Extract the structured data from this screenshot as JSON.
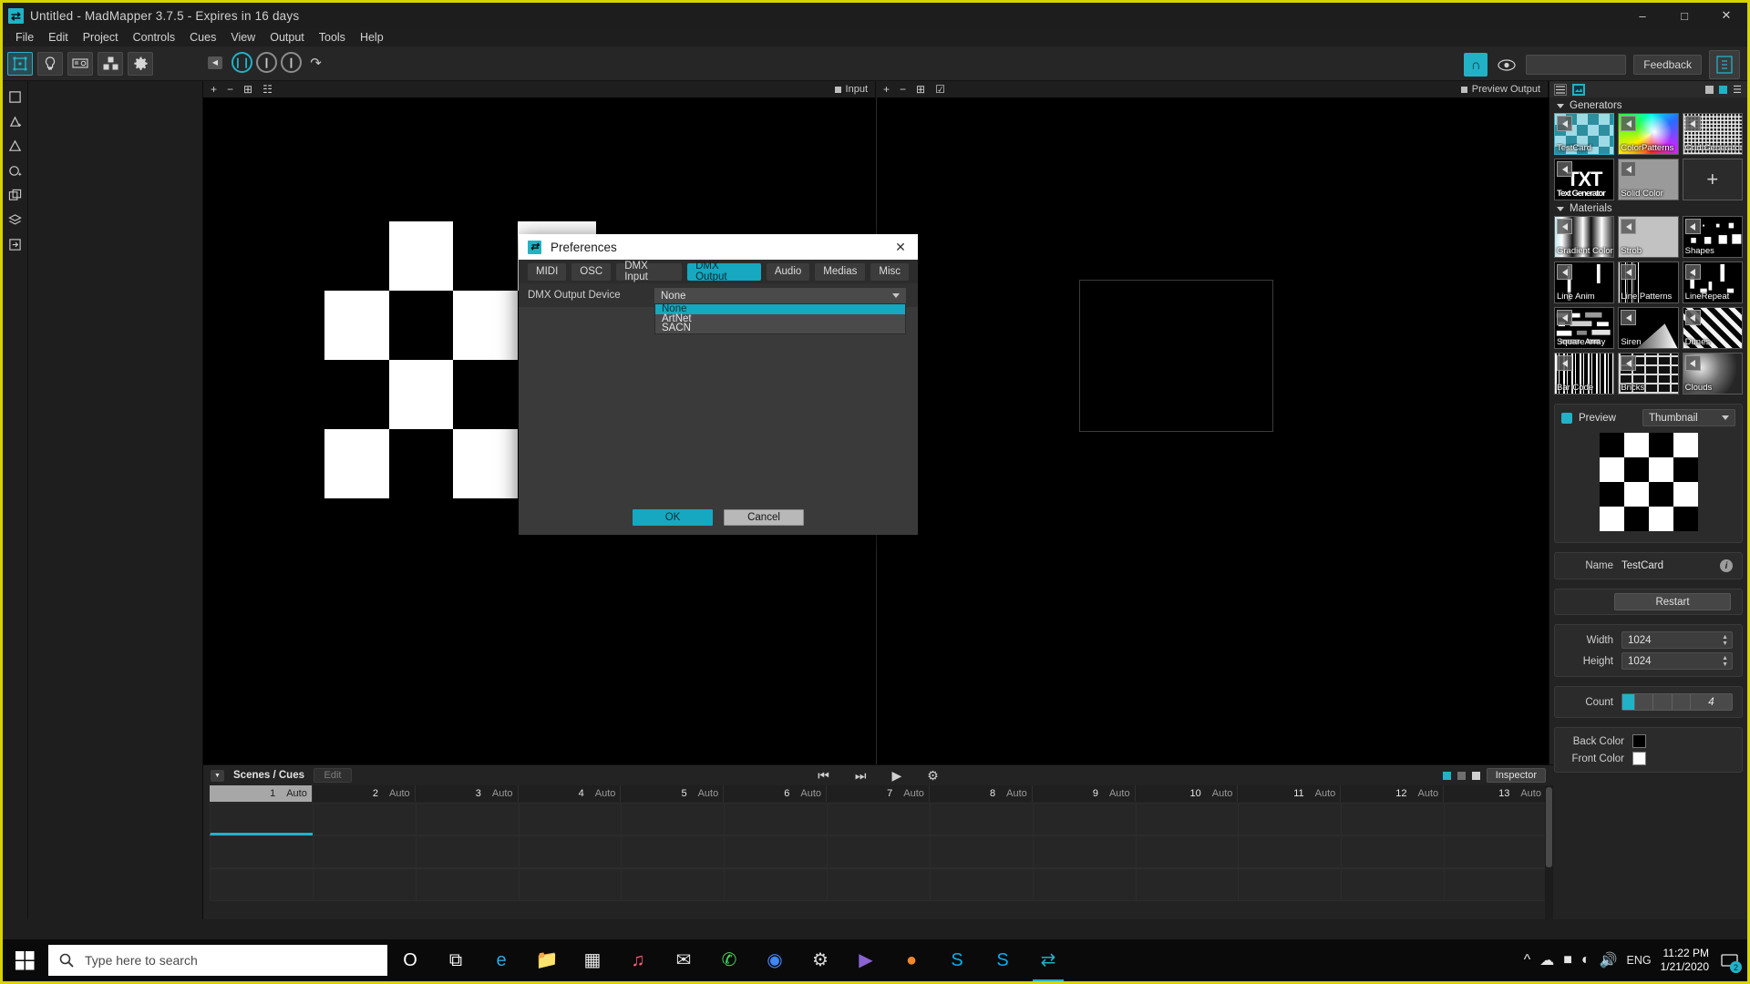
{
  "window": {
    "title": "Untitled - MadMapper 3.7.5 - Expires in 16 days",
    "app_icon": "madmapper-icon",
    "minimize": "minimize-icon",
    "maximize": "maximize-icon",
    "close": "close-icon"
  },
  "menu": {
    "items": [
      "File",
      "Edit",
      "Project",
      "Controls",
      "Cues",
      "View",
      "Output",
      "Tools",
      "Help"
    ]
  },
  "toolbar": {
    "buttons": [
      {
        "name": "surfaces-tool",
        "icon": "surface-icon",
        "active": true
      },
      {
        "name": "lights-tool",
        "icon": "bulb-icon",
        "active": false
      },
      {
        "name": "dmx-tool",
        "icon": "dmx-device-icon",
        "active": false
      },
      {
        "name": "modules-tool",
        "icon": "cubes-icon",
        "active": false
      },
      {
        "name": "settings-tool",
        "icon": "gear-icon",
        "active": false
      }
    ],
    "transport": [
      {
        "name": "pause-button",
        "glyph": "||",
        "style": "cyan"
      },
      {
        "name": "step-back-button",
        "glyph": "|",
        "style": "gray"
      },
      {
        "name": "step-forward-button",
        "glyph": "|",
        "style": "gray"
      },
      {
        "name": "loop-button",
        "glyph": "↷",
        "style": "plain"
      }
    ],
    "collapse_arrow": "collapse-left-icon",
    "right": {
      "magnet_icon": "magnet-icon",
      "eye_icon": "eye-icon",
      "combo_value": "",
      "feedback_label": "Feedback",
      "last_icon": "madmapper-panel-icon"
    }
  },
  "left_tools": [
    {
      "name": "quad-tool",
      "icon": "quad-icon"
    },
    {
      "name": "triangle-tool",
      "icon": "triangle-add-icon"
    },
    {
      "name": "mask-tool",
      "icon": "mask-icon"
    },
    {
      "name": "circle-tool",
      "icon": "circle-add-icon"
    },
    {
      "name": "group-tool",
      "icon": "group-icon"
    },
    {
      "name": "layers-tool",
      "icon": "layers-icon"
    },
    {
      "name": "export-tool",
      "icon": "export-icon"
    }
  ],
  "stage": {
    "input_label": "Input",
    "preview_output_label": "Preview Output",
    "left_icons": [
      "add-icon",
      "minus-icon",
      "fit-icon",
      "grid-icon"
    ],
    "right_icons": [
      "add-icon",
      "minus-icon",
      "fit-icon",
      "select-icon"
    ]
  },
  "right_panel": {
    "tabs": [
      {
        "name": "list-tab",
        "selected": false
      },
      {
        "name": "media-tab",
        "selected": true
      }
    ],
    "generators": {
      "title": "Generators",
      "items": [
        {
          "label": "TestCard",
          "class": "t-testcard",
          "selected": true
        },
        {
          "label": "ColorPatterns",
          "class": "t-colorpat",
          "selected": false
        },
        {
          "label": "Grid Generator",
          "class": "t-grid",
          "selected": false
        },
        {
          "label": "Text Generator",
          "class": "t-txt",
          "selected": false,
          "text": "TXT"
        },
        {
          "label": "Solid Color",
          "class": "t-solid",
          "selected": false
        },
        {
          "label": "",
          "class": "t-add",
          "add": true,
          "selected": false
        }
      ]
    },
    "materials": {
      "title": "Materials",
      "items": [
        {
          "label": "Gradient Color",
          "class": "t-grad"
        },
        {
          "label": "Strob",
          "class": "t-strob"
        },
        {
          "label": "Shapes",
          "class": "t-shapes"
        },
        {
          "label": "Line Anim",
          "class": "t-lineanim"
        },
        {
          "label": "Line Patterns",
          "class": "t-linepat"
        },
        {
          "label": "LineRepeat",
          "class": "t-linerep"
        },
        {
          "label": "SquareArray",
          "class": "t-sqarray"
        },
        {
          "label": "Siren",
          "class": "t-siren"
        },
        {
          "label": "Dunes",
          "class": "t-dunes"
        },
        {
          "label": "Bar Code",
          "class": "t-barcode"
        },
        {
          "label": "Bricks",
          "class": "t-bricks"
        },
        {
          "label": "Clouds",
          "class": "t-clouds"
        }
      ]
    },
    "preview": {
      "label": "Preview",
      "mode": "Thumbnail",
      "dropdown_icon": "chevron-down-icon"
    },
    "properties": {
      "name_label": "Name",
      "name_value": "TestCard",
      "info_icon": "info-icon",
      "restart_label": "Restart",
      "width_label": "Width",
      "width_value": "1024",
      "height_label": "Height",
      "height_value": "1024",
      "count_label": "Count",
      "count_value": "4",
      "back_color_label": "Back Color",
      "back_color": "#000000",
      "front_color_label": "Front Color",
      "front_color": "#ffffff"
    }
  },
  "scenes_cues": {
    "title": "Scenes / Cues",
    "edit_label": "Edit",
    "transport": [
      {
        "name": "cue-prev-button",
        "icon": "skip-back-icon"
      },
      {
        "name": "cue-next-button",
        "icon": "skip-forward-icon"
      },
      {
        "name": "cue-play-button",
        "icon": "play-icon"
      },
      {
        "name": "cue-settings-button",
        "icon": "gear-icon"
      }
    ],
    "inspector_label": "Inspector",
    "columns": [
      {
        "num": "1",
        "mode": "Auto",
        "selected": true
      },
      {
        "num": "2",
        "mode": "Auto",
        "selected": false
      },
      {
        "num": "3",
        "mode": "Auto",
        "selected": false
      },
      {
        "num": "4",
        "mode": "Auto",
        "selected": false
      },
      {
        "num": "5",
        "mode": "Auto",
        "selected": false
      },
      {
        "num": "6",
        "mode": "Auto",
        "selected": false
      },
      {
        "num": "7",
        "mode": "Auto",
        "selected": false
      },
      {
        "num": "8",
        "mode": "Auto",
        "selected": false
      },
      {
        "num": "9",
        "mode": "Auto",
        "selected": false
      },
      {
        "num": "10",
        "mode": "Auto",
        "selected": false
      },
      {
        "num": "11",
        "mode": "Auto",
        "selected": false
      },
      {
        "num": "12",
        "mode": "Auto",
        "selected": false
      },
      {
        "num": "13",
        "mode": "Auto",
        "selected": false
      }
    ]
  },
  "preferences": {
    "title": "Preferences",
    "icon": "madmapper-icon",
    "close_icon": "close-icon",
    "tabs": [
      {
        "label": "MIDI",
        "active": false
      },
      {
        "label": "OSC",
        "active": false
      },
      {
        "label": "DMX Input",
        "active": false
      },
      {
        "label": "DMX Output",
        "active": true
      },
      {
        "label": "Audio",
        "active": false
      },
      {
        "label": "Medias",
        "active": false
      },
      {
        "label": "Misc",
        "active": false
      }
    ],
    "field_label": "DMX Output Device",
    "field_value": "None",
    "dropdown_icon": "chevron-down-icon",
    "options": [
      {
        "label": "None",
        "highlighted": true
      },
      {
        "label": "ArtNet",
        "highlighted": false
      },
      {
        "label": "SACN",
        "highlighted": false
      }
    ],
    "ok_label": "OK",
    "cancel_label": "Cancel"
  },
  "taskbar": {
    "start_icon": "windows-start-icon",
    "search_icon": "search-icon",
    "search_placeholder": "Type here to search",
    "icons": [
      {
        "name": "cortana-icon",
        "glyph": "O",
        "color": "#ffffff"
      },
      {
        "name": "task-view-icon",
        "glyph": "⧉",
        "color": "#ffffff"
      },
      {
        "name": "edge-icon",
        "glyph": "e",
        "color": "#2ba7e0"
      },
      {
        "name": "file-explorer-icon",
        "glyph": "📁",
        "color": "#ffc04d"
      },
      {
        "name": "microsoft-store-icon",
        "glyph": "▦",
        "color": "#e8e8e8"
      },
      {
        "name": "itunes-icon",
        "glyph": "♫",
        "color": "#ff5e7a"
      },
      {
        "name": "mail-icon",
        "glyph": "✉",
        "color": "#e8e8e8"
      },
      {
        "name": "whatsapp-icon",
        "glyph": "✆",
        "color": "#4fce5d"
      },
      {
        "name": "chrome-icon",
        "glyph": "◉",
        "color": "#4286f5"
      },
      {
        "name": "settings-icon",
        "glyph": "⚙",
        "color": "#d8d8d8"
      },
      {
        "name": "plex-icon",
        "glyph": "▶",
        "color": "#8a63d2"
      },
      {
        "name": "messenger-icon",
        "glyph": "●",
        "color": "#f5862b"
      },
      {
        "name": "skype-icon",
        "glyph": "S",
        "color": "#00aff0"
      },
      {
        "name": "skype-business-icon",
        "glyph": "S",
        "color": "#00aff0"
      },
      {
        "name": "madmapper-taskbar-icon",
        "glyph": "⇄",
        "color": "#21b2c8",
        "active": true
      }
    ],
    "tray": {
      "chevron_icon": "chevron-up-icon",
      "cloud_icon": "cloud-icon",
      "battery_icon": "battery-icon",
      "wifi_icon": "wifi-icon",
      "volume_icon": "volume-icon",
      "language": "ENG",
      "time": "11:22 PM",
      "date": "1/21/2020",
      "notification_icon": "notification-icon",
      "notification_count": "2"
    }
  }
}
